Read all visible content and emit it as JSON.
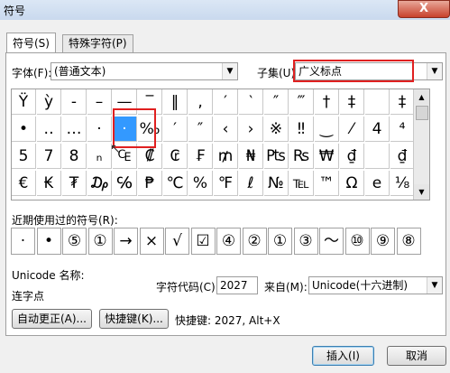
{
  "window": {
    "title": "符号",
    "close_label": "X"
  },
  "tabs": [
    {
      "label": "符号(S)"
    },
    {
      "label": "特殊字符(P)"
    }
  ],
  "font": {
    "label": "字体(F):",
    "value": "(普通文本)"
  },
  "subset": {
    "label": "子集(U):",
    "value": "广义标点"
  },
  "grid_symbols": [
    [
      "Ÿ",
      "ỳ",
      "‐",
      "–",
      "—",
      "‾",
      "‖",
      "‚",
      "′",
      "‵",
      "″",
      "‴",
      "†",
      "‡"
    ],
    [
      "•",
      "‥",
      "…",
      "‧",
      "·",
      "‰",
      "′",
      "″",
      "‹",
      "›",
      "※",
      "‼",
      "‿",
      "⁄"
    ],
    [
      "5",
      "7",
      "8",
      "ₙ",
      "₠",
      "₡",
      "₢",
      "₣",
      "₥",
      "₦",
      "₧",
      "₨",
      "₩",
      "₫"
    ],
    [
      "€",
      "₭",
      "₮",
      "₯",
      "℅",
      "₱",
      "℃",
      "%",
      "℉",
      "ℓ",
      "№",
      "℡",
      "™",
      "Ω"
    ]
  ],
  "grid_extra_col": [
    "",
    "4",
    "",
    "e"
  ],
  "grid_last_col": [
    "‡",
    "⁴",
    "₫",
    "⅛"
  ],
  "recent": {
    "label": "近期使用过的符号(R):",
    "symbols": [
      "·",
      "•",
      "⑤",
      "①",
      "→",
      "×",
      "√",
      "☑",
      "④",
      "②",
      "①",
      "③",
      "～",
      "⑩",
      "⑨",
      "⑧"
    ]
  },
  "unicode_name_label": "Unicode 名称:",
  "char_name": "连字点",
  "char_code": {
    "label": "字符代码(C):",
    "value": "2027"
  },
  "from": {
    "label": "来自(M):",
    "value": "Unicode(十六进制)"
  },
  "buttons": {
    "autocorrect": "自动更正(A)...",
    "shortcut": "快捷键(K)...",
    "insert": "插入(I)",
    "cancel": "取消"
  },
  "shortcut_text": "快捷键: 2027, Alt+X",
  "colors": {
    "highlight": "#e02020",
    "selection": "#3399ff"
  }
}
